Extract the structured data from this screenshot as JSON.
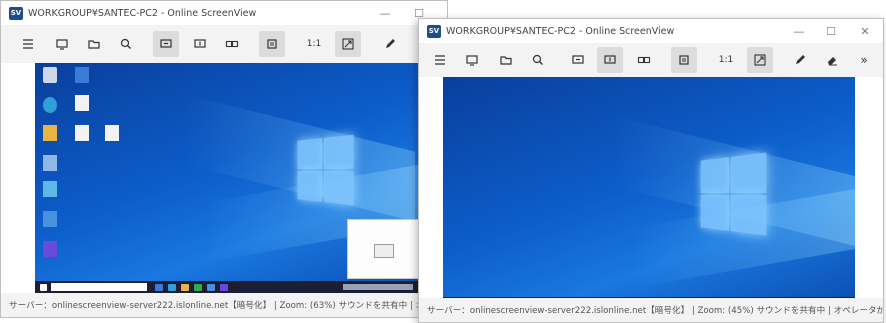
{
  "windows": [
    {
      "title": "WORKGROUP¥SANTEC-PC2 - Online ScreenView",
      "app_badge": "SV",
      "controls": {
        "minimize": "—",
        "maximize": "☐",
        "close": "✕"
      },
      "toolbar": {
        "scale_label": "1:1"
      },
      "status": "サーバー：onlinescreenview-server222.islonline.net【暗号化】 | Zoom: (63%) サウンドを共有中 | オペレータがコントロール",
      "zoom_percent": 63
    },
    {
      "title": "WORKGROUP¥SANTEC-PC2 - Online ScreenView",
      "app_badge": "SV",
      "controls": {
        "minimize": "—",
        "maximize": "☐",
        "close": "✕"
      },
      "toolbar": {
        "scale_label": "1:1",
        "more": "»"
      },
      "status": "サーバー：onlinescreenview-server222.islonline.net【暗号化】 | Zoom: (45%) サウンドを共有中 | オペレータがコントロール",
      "zoom_percent": 45
    }
  ],
  "icons": {
    "menu": "hamburger-icon",
    "monitor": "monitor-icon",
    "folder": "folder-icon",
    "search": "zoom-icon",
    "screen_select": "screen-select-icon",
    "screen_alt": "screen-alt-icon",
    "multi_screen": "multi-screen-icon",
    "clipboard": "clipboard-icon",
    "fit": "fit-window-icon",
    "pen": "pen-icon",
    "eraser": "eraser-icon"
  },
  "colors": {
    "desktop": "#0c5cc9",
    "taskbar": "#1c1f33",
    "badge": "#1b4d8f"
  }
}
